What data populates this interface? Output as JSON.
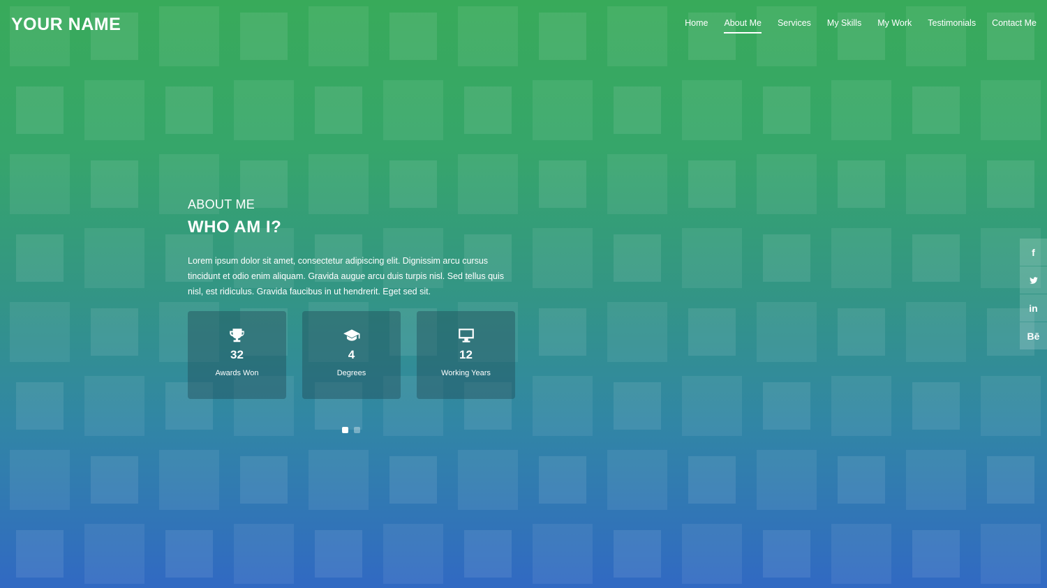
{
  "site": {
    "logo": "YOUR NAME"
  },
  "nav": {
    "items": [
      {
        "label": "Home"
      },
      {
        "label": "About Me"
      },
      {
        "label": "Services"
      },
      {
        "label": "My Skills"
      },
      {
        "label": "My Work"
      },
      {
        "label": "Testimonials"
      },
      {
        "label": "Contact Me"
      }
    ],
    "active": "About Me"
  },
  "about": {
    "eyebrow": "ABOUT ME",
    "headline": "WHO AM I?",
    "text": "Lorem ipsum dolor sit amet, consectetur adipiscing elit. Dignissim arcu cursus tincidunt et odio enim aliquam. Gravida augue arcu duis turpis nisl. Sed tellus quis nisl, est ridiculus. Gravida faucibus in ut hendrerit. Eget sed sit."
  },
  "stats": [
    {
      "icon": "trophy-icon",
      "number": "32",
      "label": "Awards Won"
    },
    {
      "icon": "graduation-cap-icon",
      "number": "4",
      "label": "Degrees"
    },
    {
      "icon": "desktop-monitor-icon",
      "number": "12",
      "label": "Working Years"
    }
  ],
  "slider": {
    "count": 2,
    "active_index": 0
  },
  "social": [
    {
      "icon": "facebook-icon",
      "glyph": "f"
    },
    {
      "icon": "twitter-icon",
      "glyph": ""
    },
    {
      "icon": "linkedin-icon",
      "glyph": "in"
    },
    {
      "icon": "behance-icon",
      "glyph": "Bē"
    }
  ],
  "colors": {
    "gradient_top": "#38aa5a",
    "gradient_bottom": "#3169c3",
    "card_background": "rgba(30,75,85,0.42)"
  }
}
